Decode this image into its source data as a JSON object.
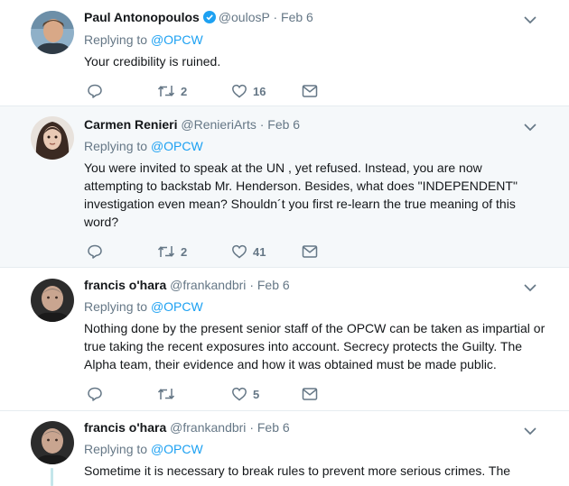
{
  "colors": {
    "accent": "#1da1f2",
    "muted": "#657786",
    "text": "#14171a",
    "highlight_bg": "#f5f8fa"
  },
  "tweets": [
    {
      "name": "Paul Antonopoulos",
      "verified": true,
      "handle": "@oulosP",
      "dot": "·",
      "time": "Feb 6",
      "replying_prefix": "Replying to",
      "replying_to": "@OPCW",
      "text": "Your credibility is ruined.",
      "retweets": "2",
      "likes": "16"
    },
    {
      "name": "Carmen Renieri",
      "handle": "@RenieriArts",
      "dot": "·",
      "time": "Feb 6",
      "replying_prefix": "Replying to",
      "replying_to": "@OPCW",
      "text": "You were invited to speak at the UN , yet refused. Instead, you are now attempting to backstab Mr. Henderson. Besides, what does \"INDEPENDENT\" investigation even mean? Shouldn´t you first re-learn the true meaning of this word?",
      "retweets": "2",
      "likes": "41"
    },
    {
      "name": "francis o'hara",
      "handle": "@frankandbri",
      "dot": "·",
      "time": "Feb 6",
      "replying_prefix": "Replying to",
      "replying_to": "@OPCW",
      "text": "Nothing done by the present senior staff of the OPCW can be taken as impartial or true taking the recent exposures into account.  Secrecy protects the Guilty. The Alpha team, their evidence and how it was obtained must be made public.",
      "retweets": "",
      "likes": "5"
    },
    {
      "name": "francis o'hara",
      "handle": "@frankandbri",
      "dot": "·",
      "time": "Feb 6",
      "replying_prefix": "Replying to",
      "replying_to": "@OPCW",
      "text": "Sometime it is necessary to break rules to prevent more serious crimes. The"
    }
  ]
}
